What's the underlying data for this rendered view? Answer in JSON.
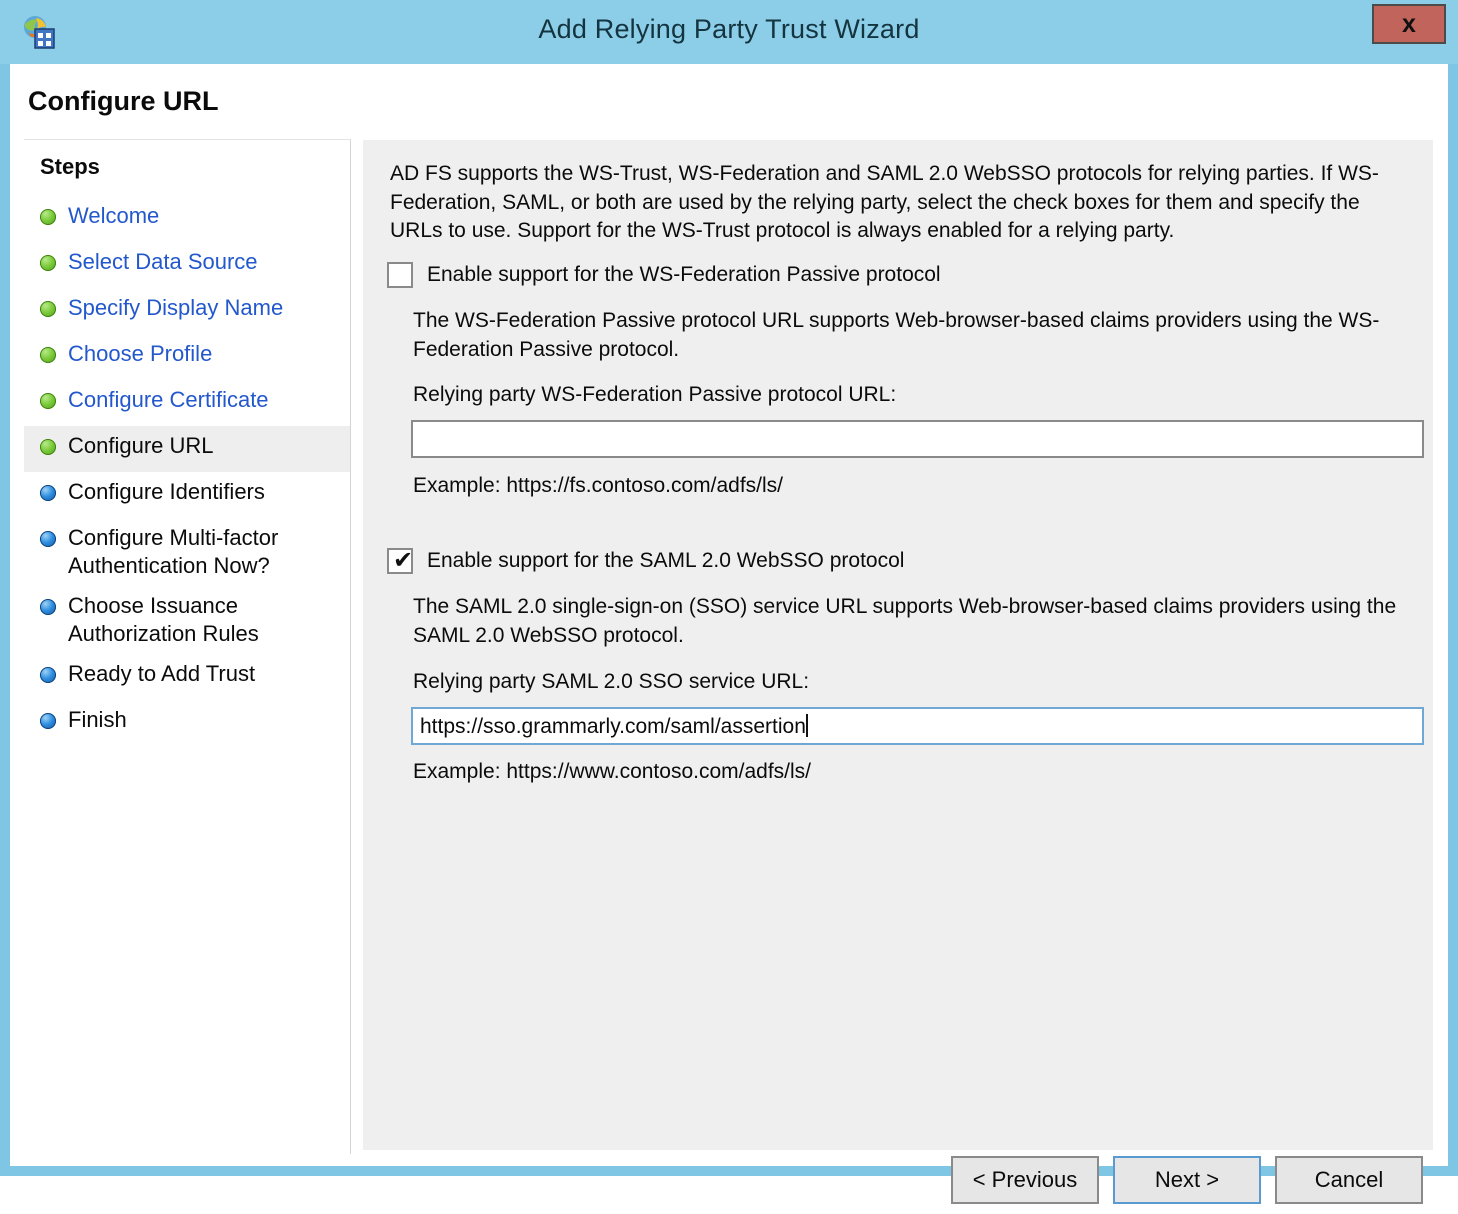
{
  "window": {
    "title": "Add Relying Party Trust Wizard",
    "icon": "adfs-relying-party-icon",
    "close_label": "x",
    "titlebar_color": "#8ccde8",
    "close_button_color": "#c0645c"
  },
  "page": {
    "title": "Configure URL"
  },
  "sidebar": {
    "heading": "Steps",
    "items": [
      {
        "label": "Welcome",
        "state": "done"
      },
      {
        "label": "Select Data Source",
        "state": "done"
      },
      {
        "label": "Specify Display Name",
        "state": "done"
      },
      {
        "label": "Choose Profile",
        "state": "done"
      },
      {
        "label": "Configure Certificate",
        "state": "done"
      },
      {
        "label": "Configure URL",
        "state": "current"
      },
      {
        "label": "Configure Identifiers",
        "state": "todo"
      },
      {
        "label": "Configure Multi-factor\nAuthentication Now?",
        "state": "todo"
      },
      {
        "label": "Choose Issuance\nAuthorization Rules",
        "state": "todo"
      },
      {
        "label": "Ready to Add Trust",
        "state": "todo"
      },
      {
        "label": "Finish",
        "state": "todo"
      }
    ]
  },
  "main": {
    "intro": "AD FS supports the WS-Trust, WS-Federation and SAML 2.0 WebSSO protocols for relying parties.  If WS-Federation, SAML, or both are used by the relying party, select the check boxes for them and specify the URLs to use.  Support for the WS-Trust protocol is always enabled for a relying party.",
    "wsfed": {
      "checkbox_label": "Enable support for the WS-Federation Passive protocol",
      "checked": false,
      "description": "The WS-Federation Passive protocol URL supports Web-browser-based claims providers using the WS-Federation Passive protocol.",
      "field_label": "Relying party WS-Federation Passive protocol URL:",
      "field_value": "",
      "example": "Example: https://fs.contoso.com/adfs/ls/"
    },
    "saml": {
      "checkbox_label": "Enable support for the SAML 2.0 WebSSO protocol",
      "checked": true,
      "check_glyph": "✔",
      "description": "The SAML 2.0 single-sign-on (SSO) service URL supports Web-browser-based claims providers using the SAML 2.0 WebSSO protocol.",
      "field_label": "Relying party SAML 2.0 SSO service URL:",
      "field_value": "https://sso.grammarly.com/saml/assertion",
      "example": "Example: https://www.contoso.com/adfs/ls/"
    }
  },
  "footer": {
    "previous_label": "< Previous",
    "next_label": "Next >",
    "cancel_label": "Cancel"
  }
}
